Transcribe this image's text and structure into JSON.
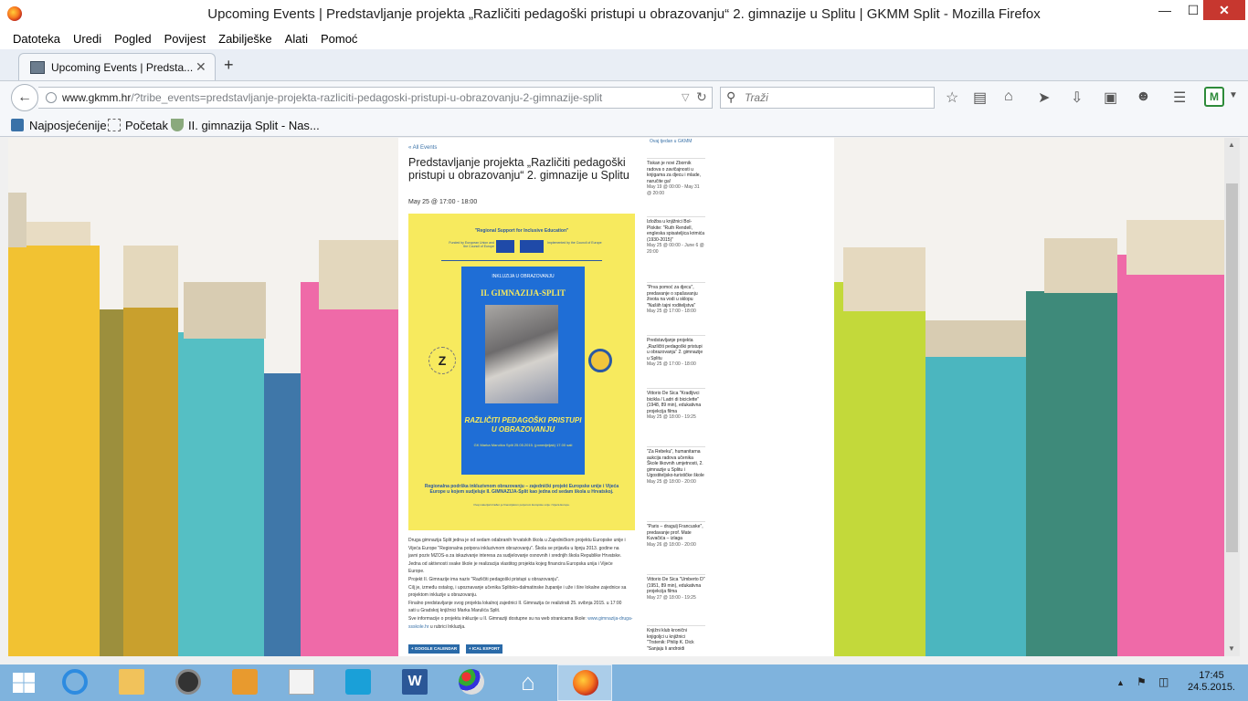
{
  "window": {
    "title": "Upcoming Events | Predstavljanje projekta „Različiti pedagoški pristupi u obrazovanju“ 2. gimnazije u Splitu | GKMM Split - Mozilla Firefox",
    "min_label": "—",
    "max_label": "☐",
    "close_label": "✕"
  },
  "menu": {
    "items": [
      "Datoteka",
      "Uredi",
      "Pogled",
      "Povijest",
      "Zabilješke",
      "Alati",
      "Pomoć"
    ]
  },
  "tabs": {
    "active_label": "Upcoming Events | Predsta...",
    "close": "✕",
    "new": "+"
  },
  "nav": {
    "url_host": "www.gkmm.hr",
    "url_path": "/?tribe_events=predstavljanje-projekta-razliciti-pedagoski-pristupi-u-obrazovanju-2-gimnazije-split",
    "search_placeholder": "Traži"
  },
  "bookmarks": {
    "items": [
      "Najposjećenije",
      "Početak",
      "II. gimnazija Split - Nas..."
    ]
  },
  "article": {
    "all_events": "« All Events",
    "title": "Predstavljanje projekta „Različiti pedagoški pristupi u obrazovanju“ 2. gimnazije u Splitu",
    "date": "May 25 @ 17:00 - 18:00",
    "poster": {
      "top": "\"Regional Support for Inclusive Education\"",
      "funded": "Funded by European Union and the Council of Europe",
      "implemented": "Implemented by the Council of Europe",
      "inclusion": "INKLUZIJA U OBRAZOVANJU",
      "school": "II. GIMNAZIJA-SPLIT",
      "title": "RAZLIČITI PEDAGOŠKI PRISTUPI U OBRAZOVANJU",
      "place": "GK Marka Marulića Split 25.05.2015. (ponedjeljak) 17.00 sati",
      "logo_left": "Z",
      "bottom": "Regionalna podrška inkluzivnom obrazovanju – zajednički projekt Europske unije i Vijeća Europe u kojem sudjeluje II. GIMNAZIJA-Split kao jedna od sedam škola u Hrvatskoj.",
      "fine": "Ovaj materijal izrađen je financijskom potporom Europske unije i Vijeća Europe."
    },
    "body": [
      "Druga gimnazija Split jedna je od sedam odabranih hrvatskih škola u Zajedničkom projektu Europske unije i",
      "Vijeća Europe \"Regionalna potpora inkluzivnom obrazovanju\". Škola se prijavila u lipnju 2013. godine na",
      "javni poziv MZOS-a za iskazivanje interesa za sudjelovanje osnovnih i srednjih škola Republike Hrvatske.",
      "Jedna od aktivnosti svake škole je realizacija vlastitog projekta kojeg financira Europska unija i Vijeće",
      "Europe.",
      "Projekt II. Gimnazije ima naziv \"Različiti pedagoški pristupi u obrazovanju\".",
      "Cilj je, između ostalog, i upoznavanje učenika Splitsko-dalmatinske županije i uže i šire lokalne zajednice sa",
      "projektom inkluzije u obrazovanju.",
      "Finalno predstavljanje svog projekta lokalnoj zajednici II. Gimnazija će realizirati 25. svibnja 2015. u 17:00",
      "sati u Gradskoj knjižnici Marka Marulića Split."
    ],
    "body_last": "Sve informacije o projektu inkluzije u II. Gimnaziji dostupne su na web stranicama škole: ",
    "body_link": "www.gimnazija-druga-ssskole.hr",
    "body_tail": " u rubrici Inkluzija.",
    "btn_gcal": "+ GOOGLE CALENDAR",
    "btn_ical": "+ ICAL EXPORT"
  },
  "sidebar": {
    "header": "Ovaj tjedan u GKMM",
    "events": [
      {
        "title": "Tiskan je novi Zbornik radova o zavičajnosti u knjigama za djecu i mlade, naručite ga!",
        "date": "May 19 @ 00:00 - May 31 @ 20:00"
      },
      {
        "title": "Izložba u knjižnici Bol-Plokite: \"Ruth Rendell, engleska spisateljica krimića (1930-2015)\"",
        "date": "May 25 @ 00:00 - June 6 @ 20:00"
      },
      {
        "title": "\"Prva pomoć za djecu\", predavanje o spašavanju života na vodi u sklopu \"Našiih tajni roditeljstva\"",
        "date": "May 25 @ 17:00 - 18:00"
      },
      {
        "title": "Predstavljanje projekta „Različiti pedagoški pristupi u obrazovanju“ 2. gimnazije u Splitu",
        "date": "May 25 @ 17:00 - 18:00"
      },
      {
        "title": "Vittorio De Sica \"Kradljivci bicikla / Ladri di biciclette\" (1948, 89 min), edukativna projekcija filma",
        "date": "May 25 @ 18:00 - 19:25"
      },
      {
        "title": "\"Za Rebeku\", humanitarna aukcija radova učenika Škole likovnih umjetnosti, 2. gimnazije u Splitu i Ugostiteljsko-turističke škole",
        "date": "May 25 @ 18:00 - 20:00"
      },
      {
        "title": "\"Paris – dragulj Francuske\", predavanje prof. Mate Kuvačića – izlaga",
        "date": "May 26 @ 18:00 - 20:00"
      },
      {
        "title": "Vittorio De Sica \"Umberto D\" (1951, 89 min), edukativna projekcija filma",
        "date": "May 27 @ 18:00 - 19:25"
      },
      {
        "title": "Knjižni klub kronični knjigoljci u knjižnici \"Trstenik: Philip K. Dick \"Sanjaju li androidi",
        "date": ""
      }
    ]
  },
  "taskbar": {
    "time": "17:45",
    "date": "24.5.2015."
  },
  "colors": {
    "poster_yellow": "#f7ea5e",
    "poster_blue": "#1f6ed6",
    "link": "#3a72a8"
  }
}
